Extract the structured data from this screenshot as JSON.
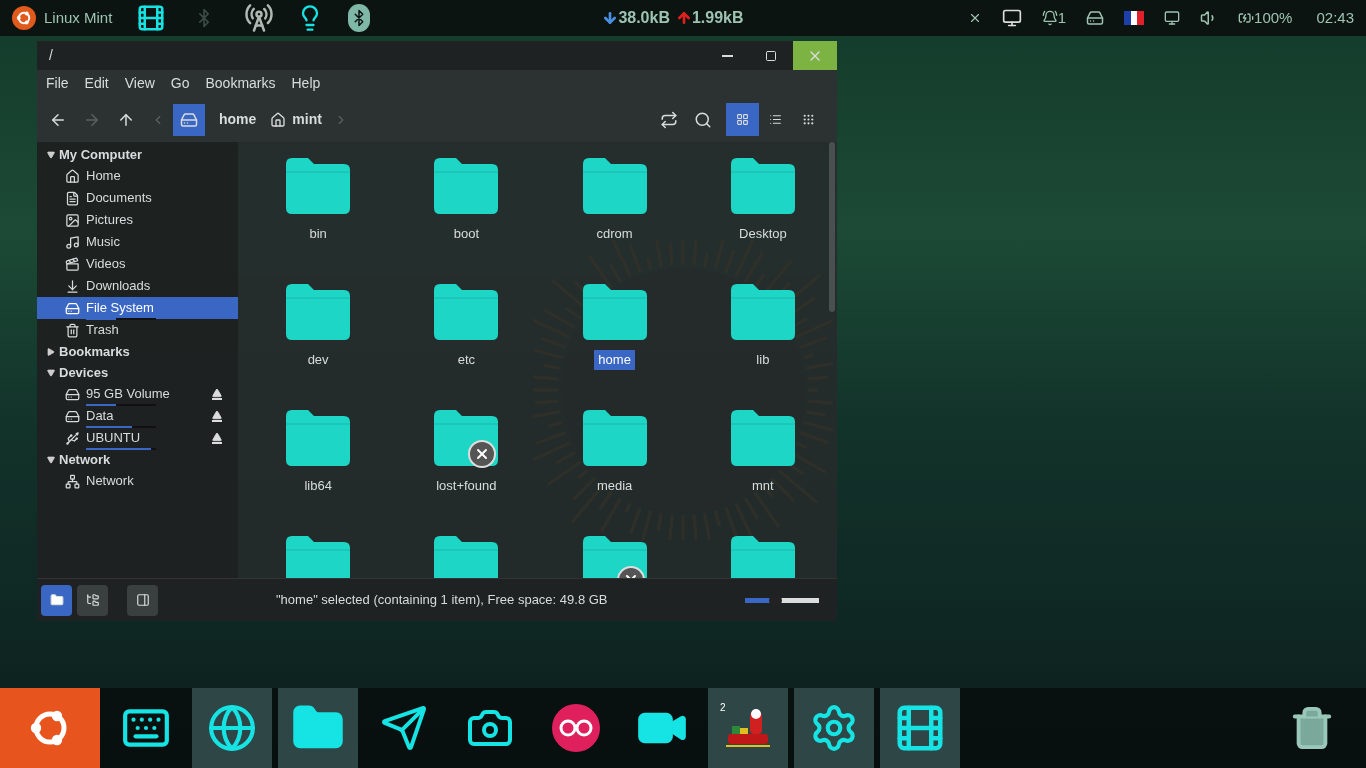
{
  "top_panel": {
    "menu_label": "Linux Mint",
    "download": "38.0kB",
    "upload": "1.99kB",
    "notification_count": "1",
    "battery": "100%",
    "clock": "02:43"
  },
  "window": {
    "title": "/",
    "menu": [
      "File",
      "Edit",
      "View",
      "Go",
      "Bookmarks",
      "Help"
    ],
    "breadcrumbs": [
      {
        "label": "home",
        "kind": "plain"
      },
      {
        "label": "mint",
        "kind": "home"
      }
    ],
    "views": [
      {
        "kind": "icons",
        "selected": true
      },
      {
        "kind": "list",
        "selected": false
      },
      {
        "kind": "compact",
        "selected": false
      }
    ],
    "sidebar": [
      {
        "title": "My Computer",
        "expanded": true,
        "items": [
          {
            "label": "Home",
            "kind": "home",
            "selected": false
          },
          {
            "label": "Documents",
            "kind": "document",
            "selected": false
          },
          {
            "label": "Pictures",
            "kind": "picture",
            "selected": false
          },
          {
            "label": "Music",
            "kind": "music",
            "selected": false
          },
          {
            "label": "Videos",
            "kind": "video",
            "selected": false
          },
          {
            "label": "Downloads",
            "kind": "download",
            "selected": false
          },
          {
            "label": "File System",
            "kind": "drive",
            "selected": true,
            "level": 0.43
          },
          {
            "label": "Trash",
            "kind": "trash",
            "selected": false
          }
        ]
      },
      {
        "title": "Bookmarks",
        "expanded": false
      },
      {
        "title": "Devices",
        "expanded": true,
        "items": [
          {
            "label": "95 GB Volume",
            "kind": "drive",
            "selected": false,
            "level": 0.43,
            "eject": true
          },
          {
            "label": "Data",
            "kind": "drive",
            "selected": false,
            "level": 0.66,
            "eject": true
          },
          {
            "label": "UBUNTU",
            "kind": "usb",
            "selected": false,
            "level": 0.93,
            "eject": true
          }
        ]
      },
      {
        "title": "Network",
        "expanded": true,
        "items": [
          {
            "label": "Network",
            "kind": "network",
            "selected": false
          }
        ]
      }
    ],
    "files": [
      {
        "name": "bin",
        "selected": false,
        "emblem": false
      },
      {
        "name": "boot",
        "selected": false,
        "emblem": false
      },
      {
        "name": "cdrom",
        "selected": false,
        "emblem": false
      },
      {
        "name": "Desktop",
        "selected": false,
        "emblem": false
      },
      {
        "name": "dev",
        "selected": false,
        "emblem": false
      },
      {
        "name": "etc",
        "selected": false,
        "emblem": false
      },
      {
        "name": "home",
        "selected": true,
        "emblem": false
      },
      {
        "name": "lib",
        "selected": false,
        "emblem": false
      },
      {
        "name": "lib64",
        "selected": false,
        "emblem": false
      },
      {
        "name": "lost+found",
        "selected": false,
        "emblem": true
      },
      {
        "name": "media",
        "selected": false,
        "emblem": false
      },
      {
        "name": "mnt",
        "selected": false,
        "emblem": false
      }
    ],
    "cut_off_folders": [
      {
        "emblem": false
      },
      {
        "emblem": false
      },
      {
        "emblem": true
      },
      {
        "emblem": false
      }
    ],
    "pane_buttons": [
      {
        "kind": "places",
        "selected": true
      },
      {
        "kind": "tree",
        "selected": false
      }
    ],
    "status": "\"home\" selected (containing 1 item), Free space: 49.8 GB",
    "zoom": {
      "level": 0.4
    }
  },
  "dock": [
    {
      "kind": "menu",
      "active": false
    },
    {
      "kind": "keyboard",
      "active": false
    },
    {
      "kind": "browser",
      "active": true
    },
    {
      "kind": "files",
      "active": true
    },
    {
      "kind": "send",
      "active": false
    },
    {
      "kind": "screenshot",
      "active": false
    },
    {
      "kind": "flickr",
      "active": false
    },
    {
      "kind": "camera",
      "active": false
    },
    {
      "kind": "santa",
      "active": true,
      "badge": "2"
    },
    {
      "kind": "gear",
      "active": true
    },
    {
      "kind": "film",
      "active": true
    },
    {
      "kind": "trash",
      "active": false
    }
  ]
}
